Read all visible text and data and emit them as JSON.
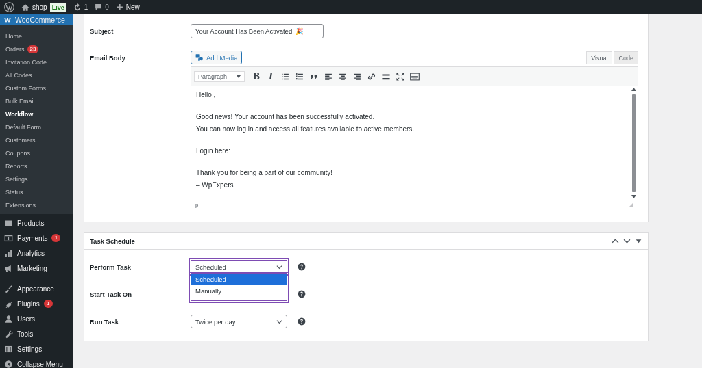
{
  "admin_bar": {
    "site": "shop",
    "site_badge": "Live",
    "updates": "1",
    "comments": "0",
    "new": "New"
  },
  "sidebar": {
    "header": "WooCommerce",
    "submenu": [
      {
        "label": "Home",
        "selected": false
      },
      {
        "label": "Orders",
        "badge": "23",
        "selected": false
      },
      {
        "label": "Invitation Code",
        "selected": false
      },
      {
        "label": "All Codes",
        "selected": false
      },
      {
        "label": "Custom Forms",
        "selected": false
      },
      {
        "label": "Bulk Email",
        "selected": false
      },
      {
        "label": "Workflow",
        "selected": true
      },
      {
        "label": "Default Form",
        "selected": false
      },
      {
        "label": "Customers",
        "selected": false
      },
      {
        "label": "Coupons",
        "selected": false
      },
      {
        "label": "Reports",
        "selected": false
      },
      {
        "label": "Settings",
        "selected": false
      },
      {
        "label": "Status",
        "selected": false
      },
      {
        "label": "Extensions",
        "selected": false
      }
    ],
    "menu_groups": [
      [
        {
          "label": "Products"
        },
        {
          "label": "Payments",
          "badge": "1"
        },
        {
          "label": "Analytics"
        },
        {
          "label": "Marketing"
        }
      ],
      [
        {
          "label": "Appearance"
        },
        {
          "label": "Plugins",
          "badge": "1"
        },
        {
          "label": "Users"
        },
        {
          "label": "Tools"
        },
        {
          "label": "Settings"
        },
        {
          "label": "Collapse Menu"
        }
      ]
    ]
  },
  "email": {
    "subject_label": "Subject",
    "subject_value": "Your Account Has Been Activated! 🎉",
    "body_label": "Email Body",
    "add_media": "Add Media",
    "tabs": [
      {
        "label": "Visual",
        "selected": true
      },
      {
        "label": "Code",
        "selected": false
      }
    ],
    "format": "Paragraph",
    "bold": "B",
    "italic": "I",
    "paragraphs": [
      [
        "Hello ,"
      ],
      [
        "Good news! Your account has been successfully activated.",
        "You can now log in and access all features available to active members."
      ],
      [
        "Login here:"
      ],
      [
        "Thank you for being a part of our community!",
        "– WpExpers"
      ]
    ],
    "path": "p"
  },
  "schedule": {
    "title": "Task Schedule",
    "rows": [
      {
        "label": "Perform Task",
        "value": "Scheduled",
        "expanded": true,
        "options": [
          {
            "label": "Scheduled",
            "selected": true
          },
          {
            "label": "Manually",
            "selected": false
          }
        ]
      },
      {
        "label": "Start Task On"
      },
      {
        "label": "Run Task",
        "value": "Twice per day",
        "expanded": false
      }
    ]
  }
}
